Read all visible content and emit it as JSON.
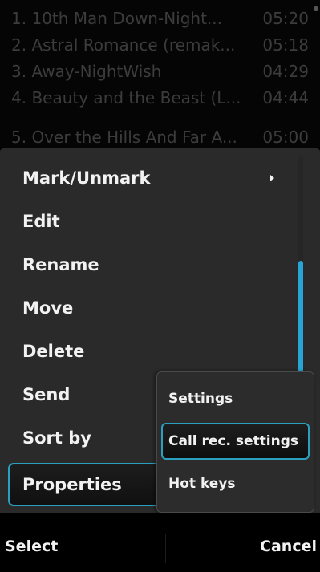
{
  "playlist": {
    "rows": [
      {
        "title": "1. 10th Man Down-Night...",
        "time": "05:20"
      },
      {
        "title": "2. Astral Romance (remak...",
        "time": "05:18"
      },
      {
        "title": "3. Away-NightWish",
        "time": "04:29"
      },
      {
        "title": "4. Beauty and the Beast (L...",
        "time": "04:44"
      },
      {
        "title": "5. Over the Hills And Far A...",
        "time": "05:00"
      }
    ]
  },
  "menu": {
    "items": [
      {
        "label": "Mark/Unmark",
        "has_submenu": true
      },
      {
        "label": "Edit"
      },
      {
        "label": "Rename"
      },
      {
        "label": "Move"
      },
      {
        "label": "Delete"
      },
      {
        "label": "Send"
      },
      {
        "label": "Sort by"
      },
      {
        "label": "Properties",
        "selected": true
      }
    ],
    "scroll_position": 0.7
  },
  "submenu": {
    "items": [
      {
        "label": "Settings"
      },
      {
        "label": "Call rec. settings",
        "selected": true
      },
      {
        "label": "Hot keys"
      }
    ]
  },
  "softkeys": {
    "left_label": "Select",
    "right_label": "Cancel"
  },
  "colors": {
    "accent": "#27a6d6",
    "menu_background": "#2a2a2a",
    "text": "#f2f2f2"
  }
}
